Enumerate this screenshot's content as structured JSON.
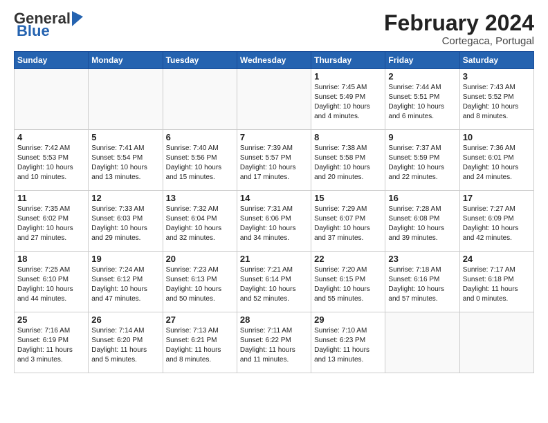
{
  "header": {
    "logo_general": "General",
    "logo_blue": "Blue",
    "month_title": "February 2024",
    "location": "Cortegaca, Portugal"
  },
  "weekdays": [
    "Sunday",
    "Monday",
    "Tuesday",
    "Wednesday",
    "Thursday",
    "Friday",
    "Saturday"
  ],
  "weeks": [
    [
      {
        "day": "",
        "info": ""
      },
      {
        "day": "",
        "info": ""
      },
      {
        "day": "",
        "info": ""
      },
      {
        "day": "",
        "info": ""
      },
      {
        "day": "1",
        "info": "Sunrise: 7:45 AM\nSunset: 5:49 PM\nDaylight: 10 hours\nand 4 minutes."
      },
      {
        "day": "2",
        "info": "Sunrise: 7:44 AM\nSunset: 5:51 PM\nDaylight: 10 hours\nand 6 minutes."
      },
      {
        "day": "3",
        "info": "Sunrise: 7:43 AM\nSunset: 5:52 PM\nDaylight: 10 hours\nand 8 minutes."
      }
    ],
    [
      {
        "day": "4",
        "info": "Sunrise: 7:42 AM\nSunset: 5:53 PM\nDaylight: 10 hours\nand 10 minutes."
      },
      {
        "day": "5",
        "info": "Sunrise: 7:41 AM\nSunset: 5:54 PM\nDaylight: 10 hours\nand 13 minutes."
      },
      {
        "day": "6",
        "info": "Sunrise: 7:40 AM\nSunset: 5:56 PM\nDaylight: 10 hours\nand 15 minutes."
      },
      {
        "day": "7",
        "info": "Sunrise: 7:39 AM\nSunset: 5:57 PM\nDaylight: 10 hours\nand 17 minutes."
      },
      {
        "day": "8",
        "info": "Sunrise: 7:38 AM\nSunset: 5:58 PM\nDaylight: 10 hours\nand 20 minutes."
      },
      {
        "day": "9",
        "info": "Sunrise: 7:37 AM\nSunset: 5:59 PM\nDaylight: 10 hours\nand 22 minutes."
      },
      {
        "day": "10",
        "info": "Sunrise: 7:36 AM\nSunset: 6:01 PM\nDaylight: 10 hours\nand 24 minutes."
      }
    ],
    [
      {
        "day": "11",
        "info": "Sunrise: 7:35 AM\nSunset: 6:02 PM\nDaylight: 10 hours\nand 27 minutes."
      },
      {
        "day": "12",
        "info": "Sunrise: 7:33 AM\nSunset: 6:03 PM\nDaylight: 10 hours\nand 29 minutes."
      },
      {
        "day": "13",
        "info": "Sunrise: 7:32 AM\nSunset: 6:04 PM\nDaylight: 10 hours\nand 32 minutes."
      },
      {
        "day": "14",
        "info": "Sunrise: 7:31 AM\nSunset: 6:06 PM\nDaylight: 10 hours\nand 34 minutes."
      },
      {
        "day": "15",
        "info": "Sunrise: 7:29 AM\nSunset: 6:07 PM\nDaylight: 10 hours\nand 37 minutes."
      },
      {
        "day": "16",
        "info": "Sunrise: 7:28 AM\nSunset: 6:08 PM\nDaylight: 10 hours\nand 39 minutes."
      },
      {
        "day": "17",
        "info": "Sunrise: 7:27 AM\nSunset: 6:09 PM\nDaylight: 10 hours\nand 42 minutes."
      }
    ],
    [
      {
        "day": "18",
        "info": "Sunrise: 7:25 AM\nSunset: 6:10 PM\nDaylight: 10 hours\nand 44 minutes."
      },
      {
        "day": "19",
        "info": "Sunrise: 7:24 AM\nSunset: 6:12 PM\nDaylight: 10 hours\nand 47 minutes."
      },
      {
        "day": "20",
        "info": "Sunrise: 7:23 AM\nSunset: 6:13 PM\nDaylight: 10 hours\nand 50 minutes."
      },
      {
        "day": "21",
        "info": "Sunrise: 7:21 AM\nSunset: 6:14 PM\nDaylight: 10 hours\nand 52 minutes."
      },
      {
        "day": "22",
        "info": "Sunrise: 7:20 AM\nSunset: 6:15 PM\nDaylight: 10 hours\nand 55 minutes."
      },
      {
        "day": "23",
        "info": "Sunrise: 7:18 AM\nSunset: 6:16 PM\nDaylight: 10 hours\nand 57 minutes."
      },
      {
        "day": "24",
        "info": "Sunrise: 7:17 AM\nSunset: 6:18 PM\nDaylight: 11 hours\nand 0 minutes."
      }
    ],
    [
      {
        "day": "25",
        "info": "Sunrise: 7:16 AM\nSunset: 6:19 PM\nDaylight: 11 hours\nand 3 minutes."
      },
      {
        "day": "26",
        "info": "Sunrise: 7:14 AM\nSunset: 6:20 PM\nDaylight: 11 hours\nand 5 minutes."
      },
      {
        "day": "27",
        "info": "Sunrise: 7:13 AM\nSunset: 6:21 PM\nDaylight: 11 hours\nand 8 minutes."
      },
      {
        "day": "28",
        "info": "Sunrise: 7:11 AM\nSunset: 6:22 PM\nDaylight: 11 hours\nand 11 minutes."
      },
      {
        "day": "29",
        "info": "Sunrise: 7:10 AM\nSunset: 6:23 PM\nDaylight: 11 hours\nand 13 minutes."
      },
      {
        "day": "",
        "info": ""
      },
      {
        "day": "",
        "info": ""
      }
    ]
  ]
}
